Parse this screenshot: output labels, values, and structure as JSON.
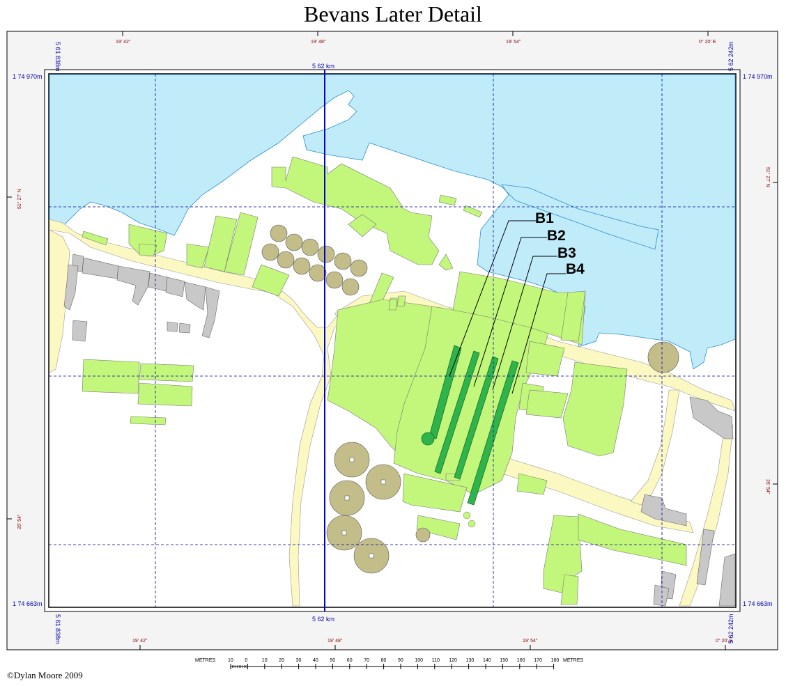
{
  "title": "Bevans Later Detail",
  "credit": "©Dylan Moore 2009",
  "grid": {
    "easting_left": "5 61 838m",
    "easting_mid": "5 62 km",
    "easting_right": "5 62 242m",
    "northing_top": "1 74 970m",
    "northing_bottom": "1 74 663m",
    "long_ticks": [
      "19' 42\"",
      "19' 48\"",
      "19' 54\"",
      "0° 20' E"
    ],
    "lat_ticks": [
      "51° 27' N",
      "26' 54\"",
      "26' 54\""
    ]
  },
  "labels": {
    "b1": "B1",
    "b2": "B2",
    "b3": "B3",
    "b4": "B4"
  },
  "scalebar": {
    "unit_left": "METRES",
    "unit_right": "METRES",
    "ticks": [
      "10",
      "0",
      "10",
      "20",
      "30",
      "40",
      "50",
      "60",
      "70",
      "80",
      "90",
      "100",
      "110",
      "120",
      "130",
      "140",
      "150",
      "160",
      "170",
      "180"
    ]
  },
  "colors": {
    "water": "#c0ecf9",
    "building": "#c3f77b",
    "house": "#c8c8c8",
    "road": "#fbf8c2",
    "tank": "#c2bd89",
    "kiln": "#2fb44c",
    "grid_major": "#0000cc",
    "grid_minor": "#0000aa"
  }
}
